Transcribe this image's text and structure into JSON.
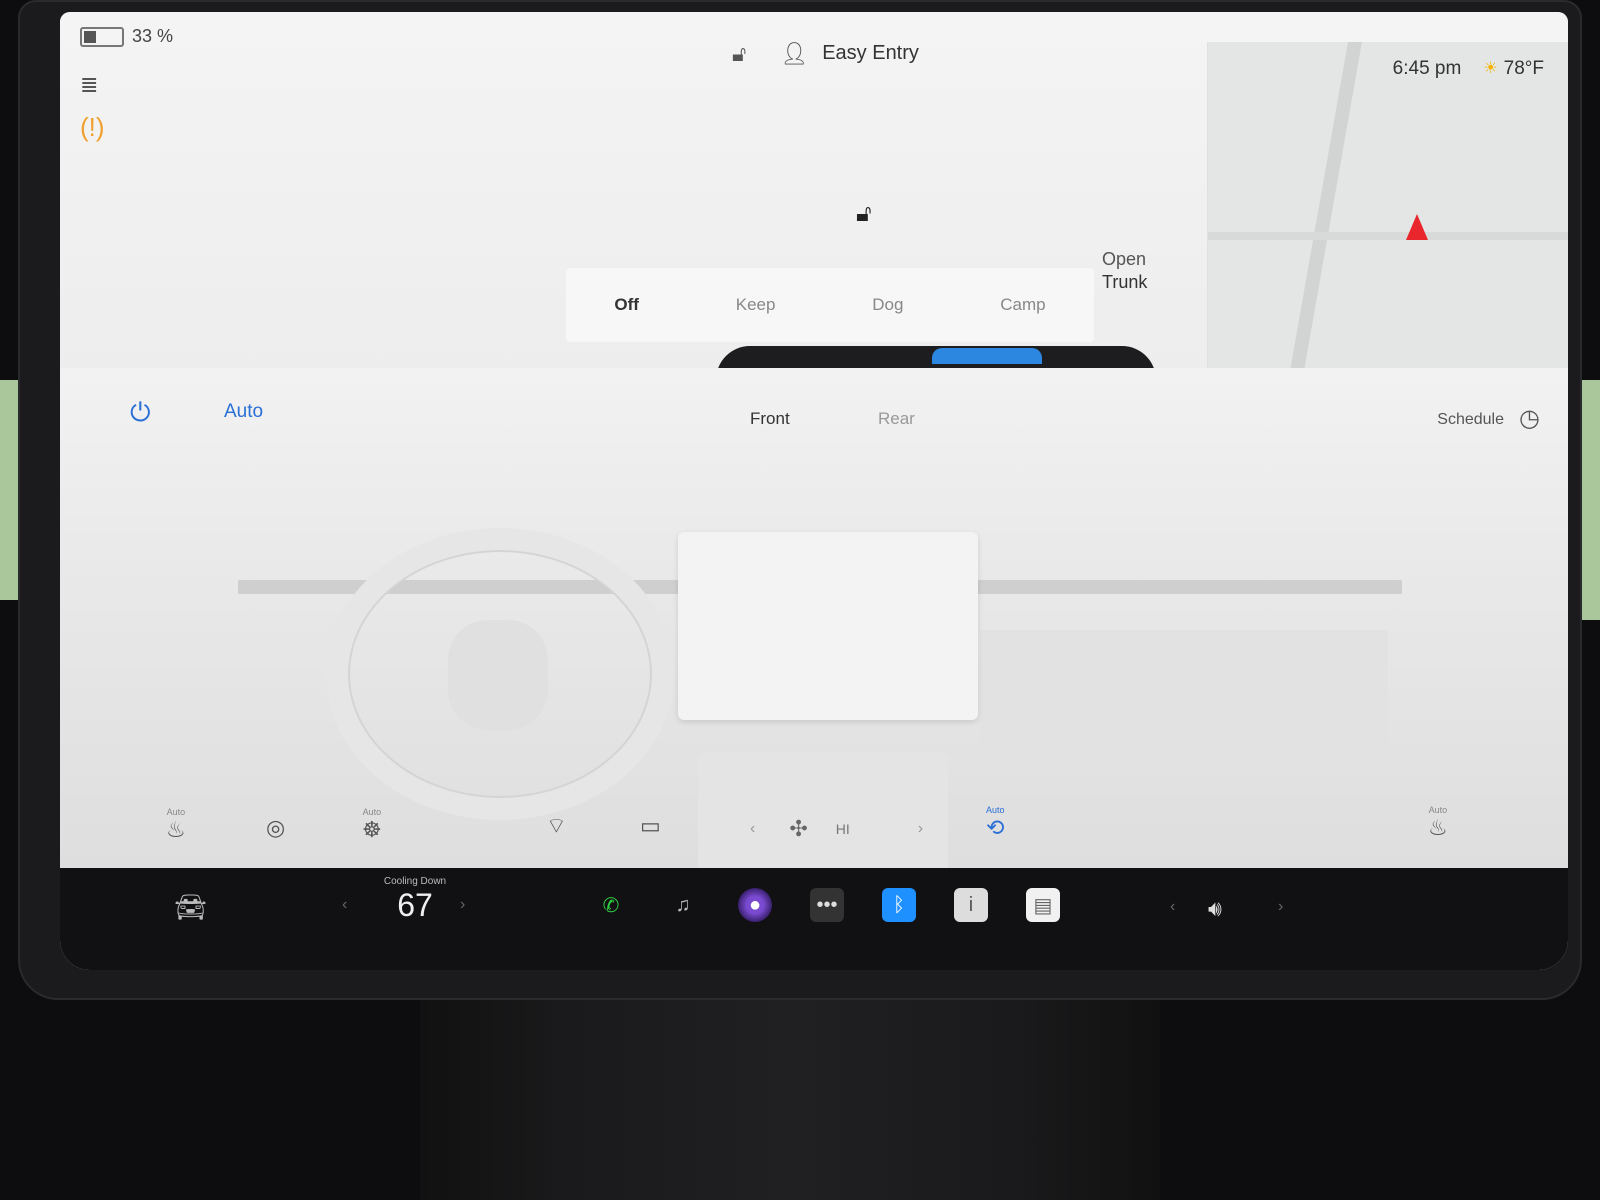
{
  "status": {
    "battery_percent": 0.33,
    "battery_label": "33 %",
    "profile_label": "Easy Entry",
    "time": "6:45 pm",
    "outside_temp": "78°F"
  },
  "car_view": {
    "trunk_line1": "Open",
    "trunk_line2": "Trunk",
    "modes": [
      "Off",
      "Keep",
      "Dog",
      "Camp"
    ]
  },
  "climate": {
    "auto_label": "Auto",
    "tabs": [
      "Front",
      "Rear"
    ],
    "schedule_label": "Schedule",
    "auto_small": "Auto",
    "fan_level": "HI"
  },
  "taskbar": {
    "cooling_label": "Cooling Down",
    "temperature": "67"
  },
  "colors": {
    "accent_blue": "#2a6fd6",
    "tire_warning": "#f0a030",
    "nav_arrow": "#e8262b",
    "phone_green": "#2ecc40",
    "bluetooth_blue": "#1e90ff"
  }
}
